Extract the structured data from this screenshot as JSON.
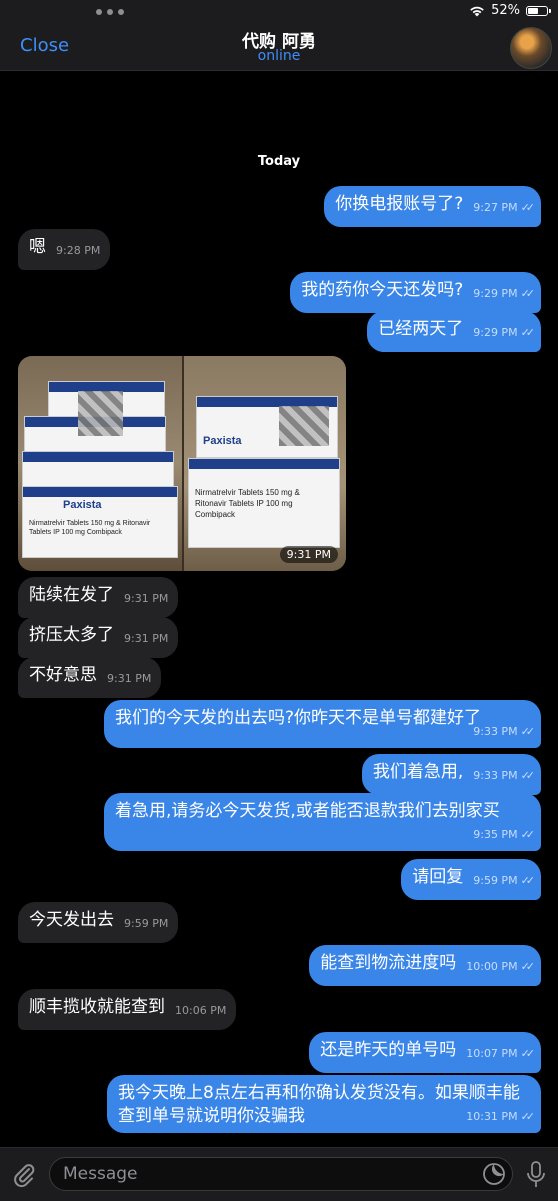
{
  "status": {
    "battery": "52%",
    "battery_level": 0.52
  },
  "header": {
    "close_label": "Close",
    "title": "代购 阿勇",
    "subtitle": "online"
  },
  "chat": {
    "date_label": "Today",
    "messages": [
      {
        "text": "你换电报账号了?",
        "time": "9:27 PM"
      },
      {
        "text": "嗯",
        "time": "9:28 PM"
      },
      {
        "text": "我的药你今天还发吗?",
        "time": "9:29 PM"
      },
      {
        "text": "已经两天了",
        "time": "9:29 PM"
      },
      {
        "photo_time": "9:31 PM",
        "box_text_1": "Nirmatrelvir Tablets 150 mg & Ritonavir Tablets IP 100 mg Combipack",
        "brand": "Paxista"
      },
      {
        "text": "陆续在发了",
        "time": "9:31 PM"
      },
      {
        "text": "挤压太多了",
        "time": "9:31 PM"
      },
      {
        "text": "不好意思",
        "time": "9:31 PM"
      },
      {
        "text": "我们的今天发的出去吗?你昨天不是单号都建好了",
        "time": "9:33 PM"
      },
      {
        "text": "我们着急用,",
        "time": "9:33 PM"
      },
      {
        "text": "着急用,请务必今天发货,或者能否退款我们去别家买",
        "time": "9:35 PM"
      },
      {
        "text": "请回复",
        "time": "9:59 PM"
      },
      {
        "text": "今天发出去",
        "time": "9:59 PM"
      },
      {
        "text": "能查到物流进度吗",
        "time": "10:00 PM"
      },
      {
        "text": "顺丰揽收就能查到",
        "time": "10:06 PM"
      },
      {
        "text": "还是昨天的单号吗",
        "time": "10:07 PM"
      },
      {
        "text": "我今天晚上8点左右再和你确认发货没有。如果顺丰能查到单号就说明你没骗我",
        "time": "10:31 PM"
      }
    ]
  },
  "composer": {
    "placeholder": "Message"
  },
  "icons": {
    "wifi": "wifi-icon",
    "battery": "battery-icon",
    "attach": "paperclip-icon",
    "sticker": "sticker-icon",
    "mic": "microphone-icon",
    "read": "double-check-icon"
  },
  "colors": {
    "accent": "#3e8ef7",
    "outgoing": "#3a86e8",
    "incoming": "#232325",
    "background": "#000000"
  }
}
